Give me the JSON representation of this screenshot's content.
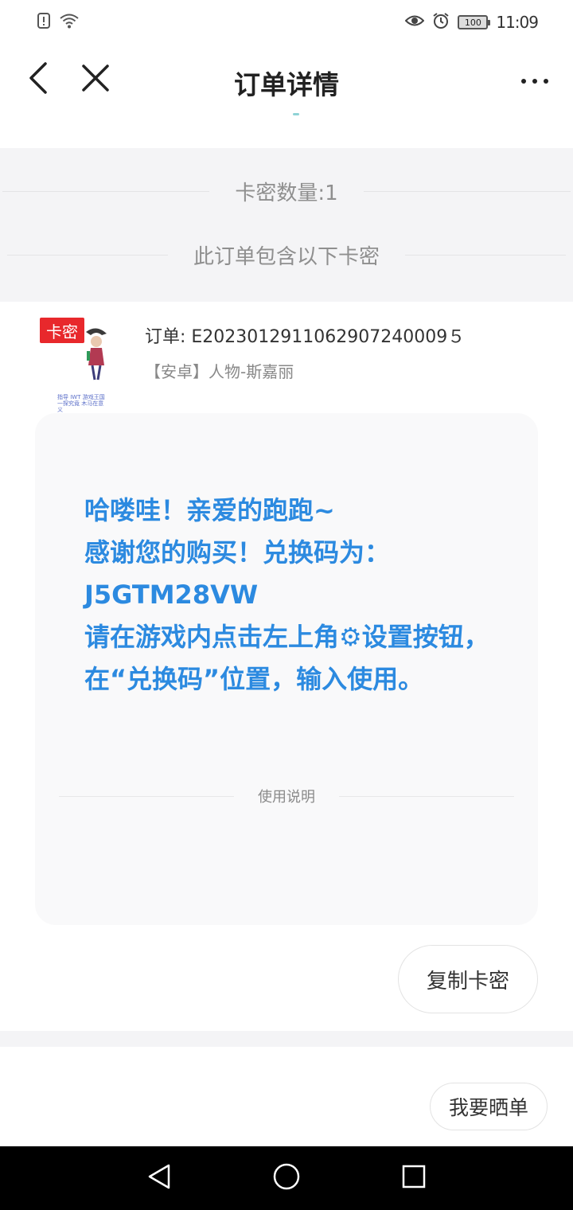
{
  "status_bar": {
    "time": "11:09",
    "battery": "100",
    "left_icons": [
      "sim-alert-icon",
      "wifi-icon"
    ],
    "right_icons": [
      "eye-icon",
      "alarm-icon",
      "battery-icon"
    ]
  },
  "header": {
    "title": "订单详情",
    "icons": [
      "back-arrow-icon",
      "close-icon",
      "more-icon"
    ]
  },
  "summary": {
    "count_label": "卡密数量:1",
    "contains_label": "此订单包含以下卡密"
  },
  "order": {
    "thumb_tag": "卡密",
    "thumb_caption": "指导 IWT 游戏王国 一探究竟 木马在意义",
    "order_number": "订单: E2023012911062907240009５",
    "product_name": "【安卓】人物-斯嘉丽"
  },
  "code_message": {
    "lines": "哈喽哇！亲爱的跑跑~\n感谢您的购买！兑换码为：\nJ5GTM28VW\n请在游戏内点击左上角⚙设置按钮，在“兑换码”位置，输入使用。",
    "instructions_label": "使用说明"
  },
  "actions": {
    "copy_label": "复制卡密",
    "share_label": "我要晒单"
  },
  "nav": {
    "icons": [
      "nav-back-icon",
      "nav-home-icon",
      "nav-recents-icon"
    ]
  },
  "colors": {
    "accent_blue": "#2c8ae0",
    "tag_red": "#e8282c",
    "band_gray": "#f4f4f6"
  }
}
